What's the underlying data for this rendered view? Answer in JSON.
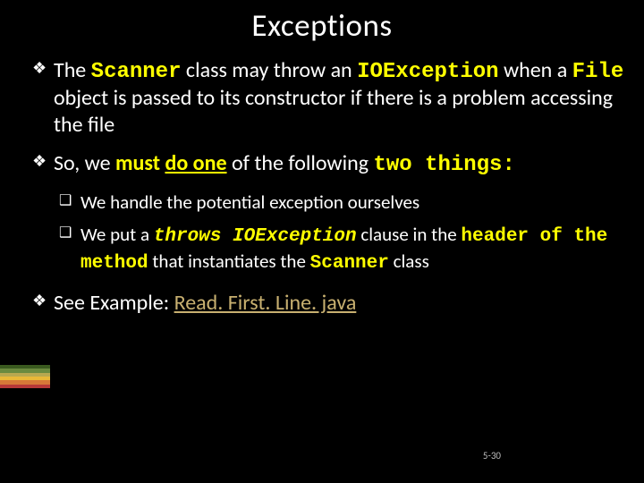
{
  "title": "Exceptions",
  "bullets": {
    "b1": {
      "t1": "The ",
      "scanner": "Scanner",
      "t2": " class may throw an ",
      "ioexception": "IOException",
      "t3": " when a ",
      "file": "File",
      "t4": " object is passed to its constructor if there is a problem accessing the file"
    },
    "b2": {
      "t1": "So, we ",
      "must": "must",
      "t2": " ",
      "do_one": "do one",
      "t3": " of the following ",
      "two_things": "two things",
      "colon": ":"
    },
    "b2a": "We handle the potential exception ourselves",
    "b2b": {
      "t1": "We put a ",
      "throws": "throws IOException",
      "t2": " clause in the ",
      "header": "header of the method",
      "t3": " that instantiates the ",
      "scanner": "Scanner",
      "t4": " class"
    },
    "b3": {
      "t1": "See Example: ",
      "link": "Read. First. Line. java"
    }
  },
  "page_number": "5-30",
  "accent_colors": [
    "#3a5a1f",
    "#6a8a3f",
    "#b8a850",
    "#e8b838",
    "#d87838",
    "#b83838"
  ]
}
